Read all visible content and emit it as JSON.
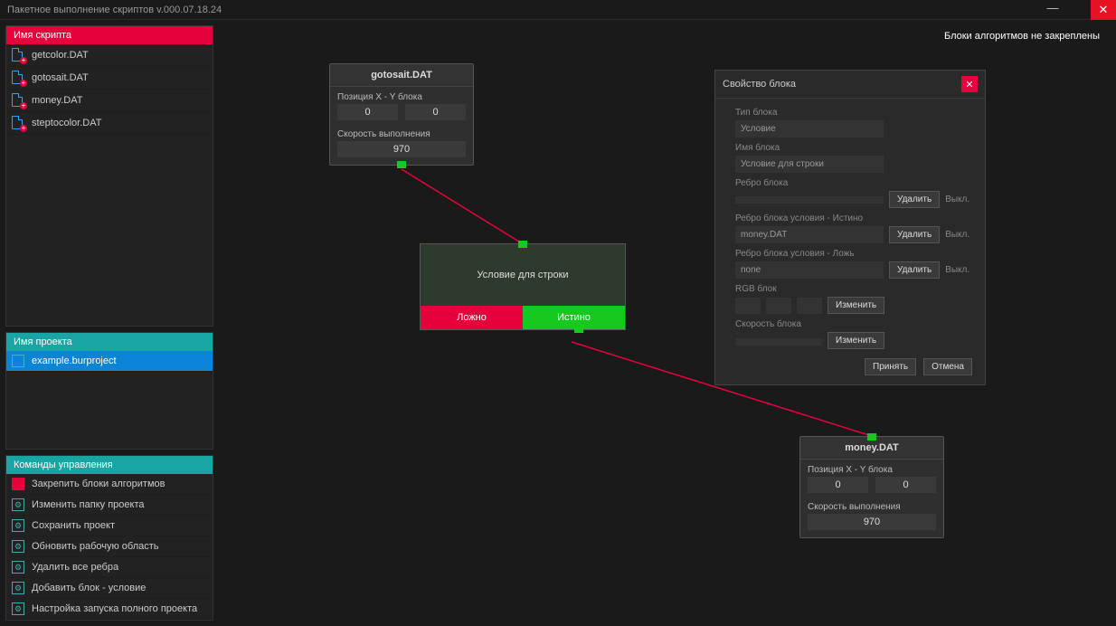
{
  "window": {
    "title": "Пакетное выполнение скриптов v.000.07.18.24"
  },
  "sidebar": {
    "scripts_header": "Имя скрипта",
    "scripts": [
      {
        "name": "getcolor.DAT"
      },
      {
        "name": "gotosait.DAT"
      },
      {
        "name": "money.DAT"
      },
      {
        "name": "steptocolor.DAT"
      }
    ],
    "project_header": "Имя проекта",
    "projects": [
      {
        "name": "example.burproject",
        "selected": true
      }
    ],
    "commands_header": "Команды управления",
    "commands": [
      {
        "label": "Закрепить блоки алгоритмов"
      },
      {
        "label": "Изменить папку проекта"
      },
      {
        "label": "Сохранить проект"
      },
      {
        "label": "Обновить рабочую область"
      },
      {
        "label": "Удалить все ребра"
      },
      {
        "label": "Добавить блок - условие"
      },
      {
        "label": "Настройка запуска полного проекта"
      }
    ]
  },
  "canvas": {
    "top_note": "Блоки алгоритмов не закреплены",
    "node1": {
      "title": "gotosait.DAT",
      "pos_label": "Позиция X - Y блока",
      "pos_x": "0",
      "pos_y": "0",
      "speed_label": "Скорость выполнения",
      "speed": "970"
    },
    "cond": {
      "title": "Условие для строки",
      "false_label": "Ложно",
      "true_label": "Истино"
    },
    "node2": {
      "title": "money.DAT",
      "pos_label": "Позиция X - Y блока",
      "pos_x": "0",
      "pos_y": "0",
      "speed_label": "Скорость выполнения",
      "speed": "970"
    }
  },
  "dialog": {
    "title": "Свойство блока",
    "type_label": "Тип блока",
    "type_value": "Условие",
    "name_label": "Имя блока",
    "name_value": "Условие для строки",
    "edge_label": "Ребро блока",
    "edge_value": "",
    "edge_true_label": "Ребро блока условия - Истино",
    "edge_true_value": "money.DAT",
    "edge_false_label": "Ребро блока условия - Ложь",
    "edge_false_value": "none",
    "rgb_label": "RGB блок",
    "speed_label": "Скорость блока",
    "speed_value": "",
    "btn_delete": "Удалить",
    "btn_off": "Выкл.",
    "btn_change": "Изменить",
    "btn_accept": "Принять",
    "btn_cancel": "Отмена"
  }
}
